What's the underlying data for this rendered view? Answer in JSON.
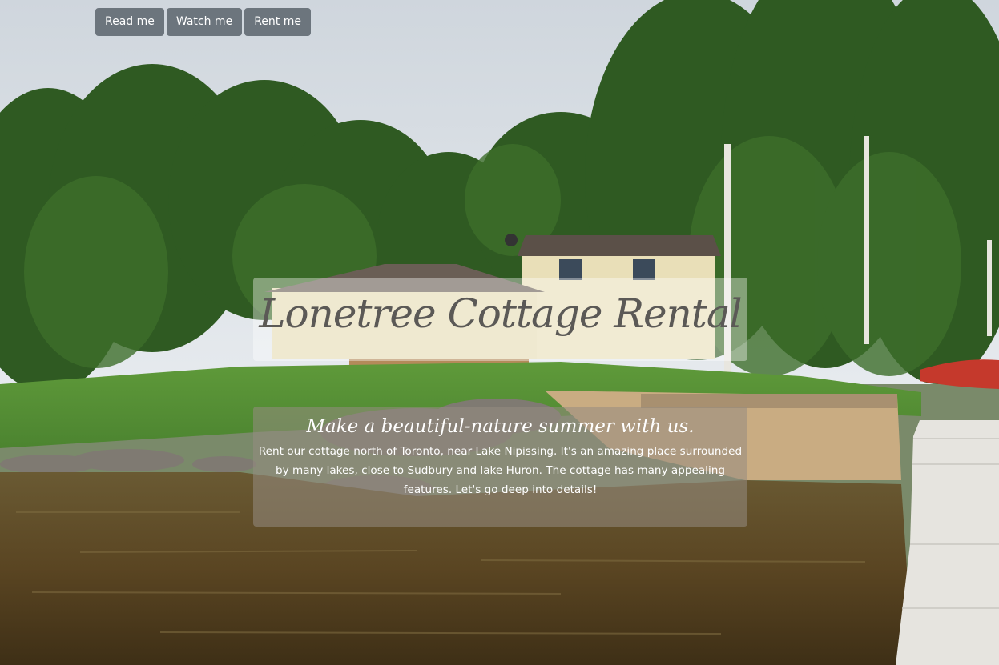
{
  "nav": {
    "buttons": [
      {
        "label": "Read me"
      },
      {
        "label": "Watch me"
      },
      {
        "label": "Rent me"
      }
    ]
  },
  "hero": {
    "title": "Lonetree Cottage Rental",
    "subtitle": "Make a beautiful-nature summer with us.",
    "description": "Rent our cottage north of Toronto, near Lake Nipissing. It's an amazing place surrounded by many lakes, close to Sudbury and lake Huron. The cottage has many appealing features. Let's go deep into details!"
  },
  "colors": {
    "button_bg": "#6c757d",
    "button_text": "#ffffff",
    "title_text": "#5b5956"
  }
}
